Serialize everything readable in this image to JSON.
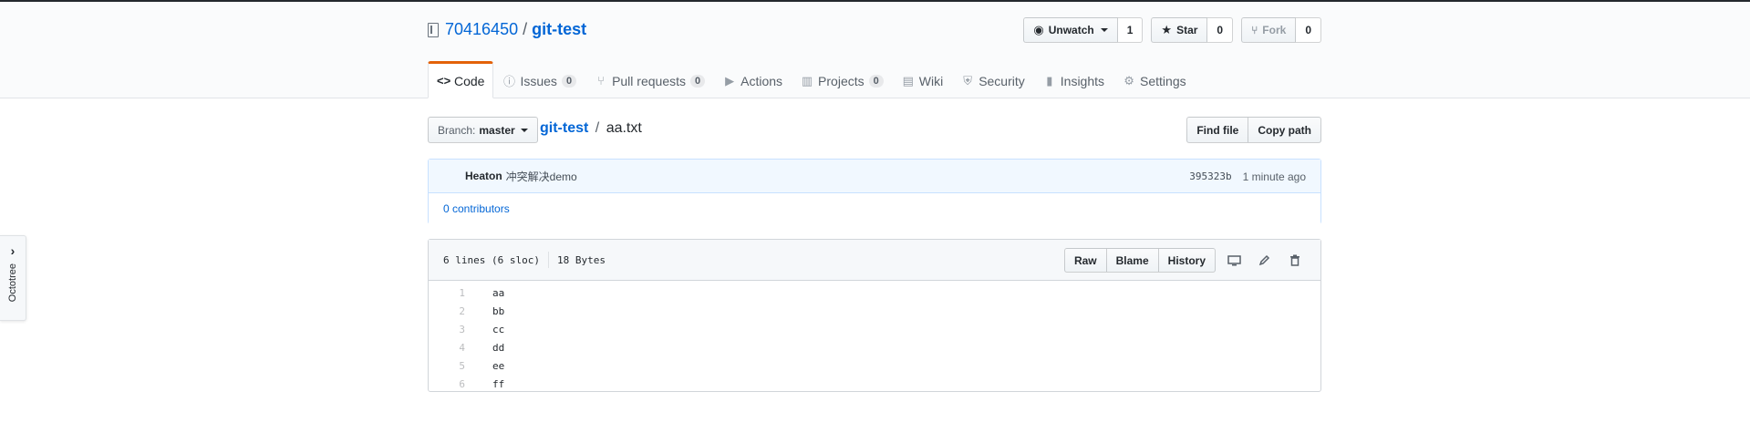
{
  "repo": {
    "owner": "70416450",
    "separator": "/",
    "name": "git-test"
  },
  "actions": {
    "watch": {
      "label": "Unwatch",
      "count": "1"
    },
    "star": {
      "label": "Star",
      "count": "0"
    },
    "fork": {
      "label": "Fork",
      "count": "0"
    }
  },
  "tabs": [
    {
      "label": "Code",
      "icon": "code-icon",
      "glyph": "<>"
    },
    {
      "label": "Issues",
      "counter": "0",
      "icon": "issue-icon",
      "glyph": "ⓘ"
    },
    {
      "label": "Pull requests",
      "counter": "0",
      "icon": "pull-request-icon",
      "glyph": "⑂"
    },
    {
      "label": "Actions",
      "icon": "play-icon",
      "glyph": "▶"
    },
    {
      "label": "Projects",
      "counter": "0",
      "icon": "project-icon",
      "glyph": "▥"
    },
    {
      "label": "Wiki",
      "icon": "book-icon",
      "glyph": "▤"
    },
    {
      "label": "Security",
      "icon": "shield-icon",
      "glyph": "⛨"
    },
    {
      "label": "Insights",
      "icon": "graph-icon",
      "glyph": "▮"
    },
    {
      "label": "Settings",
      "icon": "gear-icon",
      "glyph": "⚙"
    }
  ],
  "file_nav": {
    "branch_prefix": "Branch:",
    "branch": "master",
    "breadcrumb_repo": "git-test",
    "breadcrumb_sep": "/",
    "file_name": "aa.txt",
    "find_file": "Find file",
    "copy_path": "Copy path"
  },
  "commit": {
    "author": "Heaton",
    "message": "冲突解决demo",
    "sha": "395323b",
    "time": "1 minute ago",
    "contributors": "0 contributors"
  },
  "file": {
    "lines_info": "6 lines (6 sloc)",
    "size": "18 Bytes",
    "raw": "Raw",
    "blame": "Blame",
    "history": "History",
    "lines": [
      {
        "n": "1",
        "text": "aa"
      },
      {
        "n": "2",
        "text": "bb"
      },
      {
        "n": "3",
        "text": "cc"
      },
      {
        "n": "4",
        "text": "dd"
      },
      {
        "n": "5",
        "text": "ee"
      },
      {
        "n": "6",
        "text": "ff"
      }
    ]
  },
  "octotree": {
    "label": "Octotree"
  },
  "colors": {
    "accent": "#0366d6",
    "tab_selected": "#e36209"
  }
}
